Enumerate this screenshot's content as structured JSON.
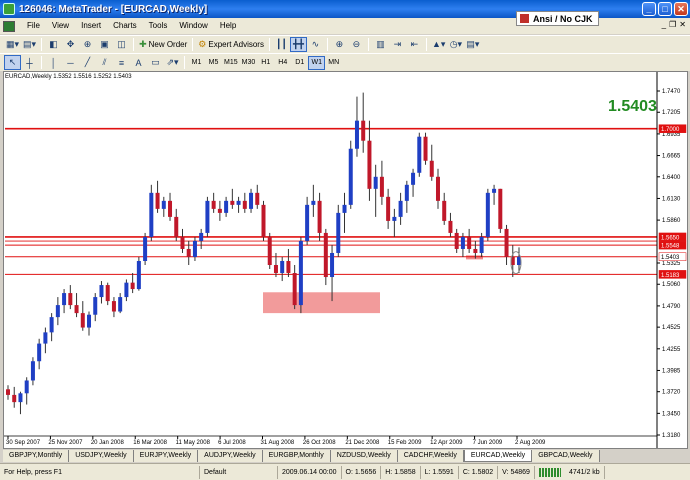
{
  "window": {
    "title": "126046: MetaTrader - [EURCAD,Weekly]"
  },
  "ime": {
    "label": "Ansi / No CJK"
  },
  "menu": [
    "File",
    "View",
    "Insert",
    "Charts",
    "Tools",
    "Window",
    "Help"
  ],
  "toolbar": {
    "new_order": "New Order",
    "expert_advisors": "Expert Advisors"
  },
  "timeframes": [
    "M1",
    "M5",
    "M15",
    "M30",
    "H1",
    "H4",
    "D1",
    "W1",
    "MN"
  ],
  "active_timeframe": "W1",
  "chart": {
    "info": "EURCAD,Weekly  1.5352 1.5516 1.5252 1.5403",
    "price_readout": "1.5403",
    "colors": {
      "bull": "#1f3fc4",
      "bear": "#c0182a",
      "level": "#e01010",
      "zone": "#f08a8a"
    },
    "y_labels": [
      "1.7470",
      "1.7205",
      "1.6935",
      "1.6665",
      "1.6400",
      "1.6130",
      "1.5860",
      "1.5325",
      "1.5060",
      "1.4790",
      "1.4525",
      "1.4255",
      "1.3985",
      "1.3720",
      "1.3450",
      "1.3180"
    ],
    "level_labels": [
      {
        "text": "1.7000",
        "price": 1.7
      },
      {
        "text": "1.5650",
        "price": 1.565
      },
      {
        "text": "1.5548",
        "price": 1.5548
      },
      {
        "text": "1.5403",
        "price": 1.5403
      },
      {
        "text": "1.5183",
        "price": 1.5183
      }
    ],
    "x_labels": [
      "30 Sep 2007",
      "25 Nov 2007",
      "20 Jan 2008",
      "16 Mar 2008",
      "11 May 2008",
      "6 Jul 2008",
      "31 Aug 2008",
      "26 Oct 2008",
      "21 Dec 2008",
      "15 Feb 2009",
      "12 Apr 2009",
      "7 Jun 2009",
      "2 Aug 2009"
    ]
  },
  "chart_data": {
    "type": "candlestick",
    "ylim": [
      1.318,
      1.747
    ],
    "horizontal_levels": [
      1.7,
      1.565,
      1.5599,
      1.5548,
      1.5403,
      1.5183
    ],
    "support_zone": {
      "from": "31 Aug 2008",
      "to": "21 Dec 2008",
      "low": 1.47,
      "high": 1.496
    },
    "ohlc": [
      [
        1.375,
        1.38,
        1.362,
        1.368
      ],
      [
        1.368,
        1.378,
        1.352,
        1.359
      ],
      [
        1.359,
        1.372,
        1.344,
        1.37
      ],
      [
        1.37,
        1.39,
        1.356,
        1.386
      ],
      [
        1.386,
        1.415,
        1.38,
        1.41
      ],
      [
        1.41,
        1.438,
        1.4,
        1.432
      ],
      [
        1.432,
        1.452,
        1.42,
        1.446
      ],
      [
        1.446,
        1.47,
        1.435,
        1.465
      ],
      [
        1.465,
        1.49,
        1.455,
        1.48
      ],
      [
        1.48,
        1.5,
        1.47,
        1.495
      ],
      [
        1.495,
        1.505,
        1.475,
        1.48
      ],
      [
        1.48,
        1.495,
        1.465,
        1.47
      ],
      [
        1.47,
        1.485,
        1.448,
        1.452
      ],
      [
        1.452,
        1.472,
        1.442,
        1.468
      ],
      [
        1.468,
        1.495,
        1.46,
        1.49
      ],
      [
        1.49,
        1.51,
        1.482,
        1.505
      ],
      [
        1.505,
        1.508,
        1.48,
        1.485
      ],
      [
        1.485,
        1.49,
        1.465,
        1.472
      ],
      [
        1.472,
        1.495,
        1.47,
        1.49
      ],
      [
        1.49,
        1.512,
        1.485,
        1.508
      ],
      [
        1.508,
        1.52,
        1.495,
        1.5
      ],
      [
        1.5,
        1.54,
        1.498,
        1.535
      ],
      [
        1.535,
        1.57,
        1.53,
        1.565
      ],
      [
        1.565,
        1.63,
        1.56,
        1.62
      ],
      [
        1.62,
        1.635,
        1.595,
        1.6
      ],
      [
        1.6,
        1.615,
        1.59,
        1.61
      ],
      [
        1.61,
        1.62,
        1.585,
        1.59
      ],
      [
        1.59,
        1.6,
        1.56,
        1.565
      ],
      [
        1.565,
        1.575,
        1.545,
        1.55
      ],
      [
        1.55,
        1.56,
        1.53,
        1.54
      ],
      [
        1.54,
        1.565,
        1.535,
        1.56
      ],
      [
        1.56,
        1.575,
        1.55,
        1.57
      ],
      [
        1.57,
        1.615,
        1.565,
        1.61
      ],
      [
        1.61,
        1.62,
        1.595,
        1.6
      ],
      [
        1.6,
        1.61,
        1.585,
        1.595
      ],
      [
        1.595,
        1.615,
        1.59,
        1.61
      ],
      [
        1.61,
        1.625,
        1.6,
        1.605
      ],
      [
        1.605,
        1.615,
        1.595,
        1.61
      ],
      [
        1.61,
        1.62,
        1.595,
        1.6
      ],
      [
        1.6,
        1.625,
        1.595,
        1.62
      ],
      [
        1.62,
        1.63,
        1.6,
        1.605
      ],
      [
        1.605,
        1.61,
        1.56,
        1.565
      ],
      [
        1.565,
        1.57,
        1.525,
        1.53
      ],
      [
        1.53,
        1.545,
        1.515,
        1.52
      ],
      [
        1.52,
        1.54,
        1.51,
        1.535
      ],
      [
        1.535,
        1.55,
        1.515,
        1.52
      ],
      [
        1.52,
        1.53,
        1.475,
        1.48
      ],
      [
        1.48,
        1.565,
        1.47,
        1.56
      ],
      [
        1.56,
        1.615,
        1.555,
        1.605
      ],
      [
        1.605,
        1.63,
        1.59,
        1.61
      ],
      [
        1.61,
        1.62,
        1.56,
        1.57
      ],
      [
        1.57,
        1.575,
        1.505,
        1.515
      ],
      [
        1.515,
        1.555,
        1.485,
        1.545
      ],
      [
        1.545,
        1.605,
        1.54,
        1.595
      ],
      [
        1.595,
        1.62,
        1.57,
        1.605
      ],
      [
        1.605,
        1.685,
        1.6,
        1.675
      ],
      [
        1.675,
        1.74,
        1.665,
        1.71
      ],
      [
        1.71,
        1.745,
        1.67,
        1.685
      ],
      [
        1.685,
        1.71,
        1.61,
        1.625
      ],
      [
        1.625,
        1.655,
        1.59,
        1.64
      ],
      [
        1.64,
        1.66,
        1.605,
        1.615
      ],
      [
        1.615,
        1.625,
        1.575,
        1.585
      ],
      [
        1.585,
        1.6,
        1.565,
        1.59
      ],
      [
        1.59,
        1.62,
        1.58,
        1.61
      ],
      [
        1.61,
        1.635,
        1.595,
        1.63
      ],
      [
        1.63,
        1.65,
        1.615,
        1.645
      ],
      [
        1.645,
        1.695,
        1.64,
        1.69
      ],
      [
        1.69,
        1.695,
        1.655,
        1.66
      ],
      [
        1.66,
        1.68,
        1.635,
        1.64
      ],
      [
        1.64,
        1.65,
        1.6,
        1.61
      ],
      [
        1.61,
        1.62,
        1.58,
        1.585
      ],
      [
        1.585,
        1.595,
        1.565,
        1.57
      ],
      [
        1.57,
        1.575,
        1.545,
        1.55
      ],
      [
        1.55,
        1.57,
        1.54,
        1.565
      ],
      [
        1.565,
        1.575,
        1.545,
        1.55
      ],
      [
        1.55,
        1.56,
        1.538,
        1.545
      ],
      [
        1.545,
        1.57,
        1.54,
        1.565
      ],
      [
        1.565,
        1.625,
        1.56,
        1.62
      ],
      [
        1.62,
        1.63,
        1.605,
        1.625
      ],
      [
        1.625,
        1.625,
        1.57,
        1.575
      ],
      [
        1.575,
        1.58,
        1.53,
        1.54
      ],
      [
        1.54,
        1.555,
        1.515,
        1.53
      ],
      [
        1.53,
        1.552,
        1.52,
        1.5403
      ]
    ]
  },
  "symbol_tabs": [
    "GBPJPY,Monthly",
    "USDJPY,Weekly",
    "EURJPY,Weekly",
    "AUDJPY,Weekly",
    "EURGBP,Monthly",
    "NZDUSD,Weekly",
    "CADCHF,Weekly",
    "EURCAD,Weekly",
    "GBPCAD,Weekly"
  ],
  "active_symbol_tab": "EURCAD,Weekly",
  "status": {
    "help": "For Help, press F1",
    "profile": "Default",
    "datetime": "2009.06.14 00:00",
    "open": "O: 1.5656",
    "high": "H: 1.5858",
    "low": "L: 1.5591",
    "close": "C: 1.5802",
    "volume": "V: 54869",
    "traffic": "4741/2 kb"
  }
}
